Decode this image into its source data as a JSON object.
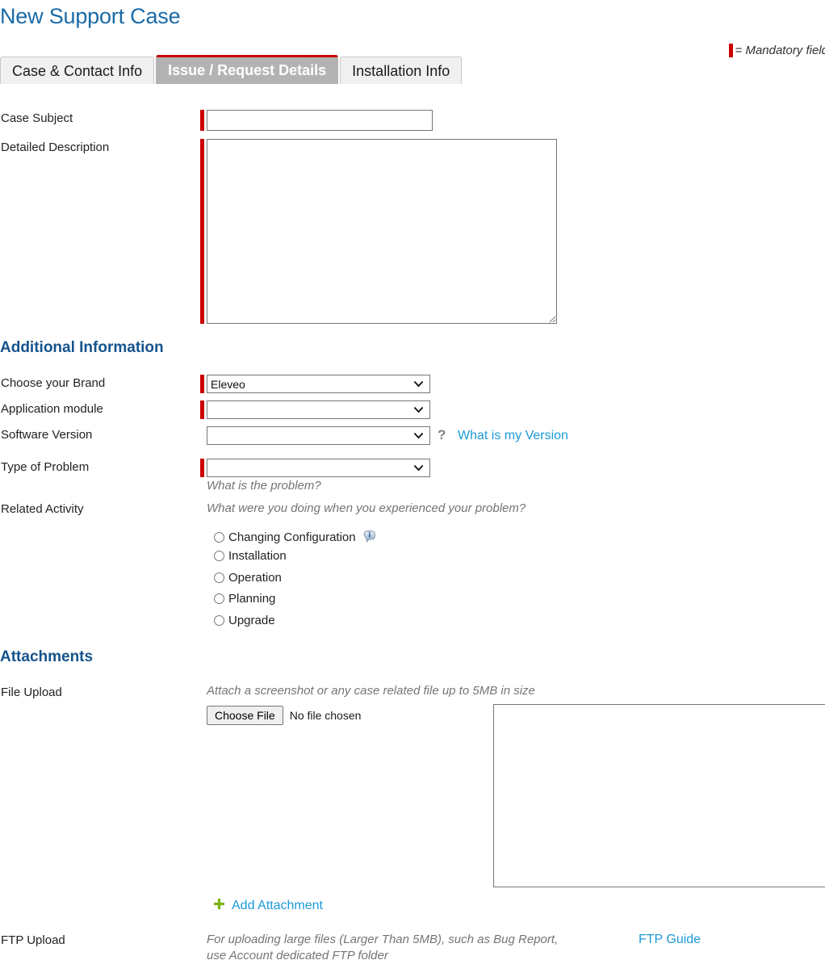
{
  "page": {
    "title": "New Support Case"
  },
  "legend": {
    "bar_color": "#cc0000",
    "text": "= Mandatory field"
  },
  "tabs": [
    {
      "label": "Case & Contact Info",
      "active": false
    },
    {
      "label": "Issue / Request Details",
      "active": true
    },
    {
      "label": "Installation Info",
      "active": false
    }
  ],
  "issue_section": {
    "case_subject": {
      "label": "Case Subject",
      "value": "",
      "mandatory": true
    },
    "detailed_description": {
      "label": "Detailed Description",
      "value": "",
      "mandatory": true
    }
  },
  "additional_information": {
    "heading": "Additional Information",
    "brand": {
      "label": "Choose your Brand",
      "value": "Eleveo",
      "mandatory": true
    },
    "application_module": {
      "label": "Application module",
      "value": "",
      "mandatory": true
    },
    "software_version": {
      "label": "Software Version",
      "value": "",
      "mandatory": false,
      "help_icon": "?",
      "help_link": "What is my Version"
    },
    "type_of_problem": {
      "label": "Type of Problem",
      "value": "",
      "mandatory": true,
      "hint": "What is the problem?"
    },
    "related_activity": {
      "label": "Related Activity",
      "hint": "What were you doing when you experienced your problem?",
      "options": [
        {
          "label": "Changing Configuration",
          "selected": false,
          "has_info": true
        },
        {
          "label": "Installation",
          "selected": false,
          "has_info": false
        },
        {
          "label": "Operation",
          "selected": false,
          "has_info": false
        },
        {
          "label": "Planning",
          "selected": false,
          "has_info": false
        },
        {
          "label": "Upgrade",
          "selected": false,
          "has_info": false
        }
      ]
    }
  },
  "attachments": {
    "heading": "Attachments",
    "file_upload": {
      "label": "File Upload",
      "hint": "Attach a screenshot or any case related file up to 5MB in size",
      "button_label": "Choose File",
      "file_status": "No file chosen",
      "add_attachment_label": "Add Attachment"
    },
    "ftp_upload": {
      "label": "FTP Upload",
      "hint": "For uploading large files (Larger Than 5MB), such as Bug Report, use Account dedicated FTP folder",
      "guide_link": "FTP Guide"
    }
  },
  "colors": {
    "title_blue": "#1a6ba8",
    "heading_blue": "#16538c",
    "link_cyan": "#1c9ad6",
    "mandatory_red": "#cc0000",
    "active_tab_gray": "#b3b3b3",
    "plus_green": "#7ab317"
  }
}
